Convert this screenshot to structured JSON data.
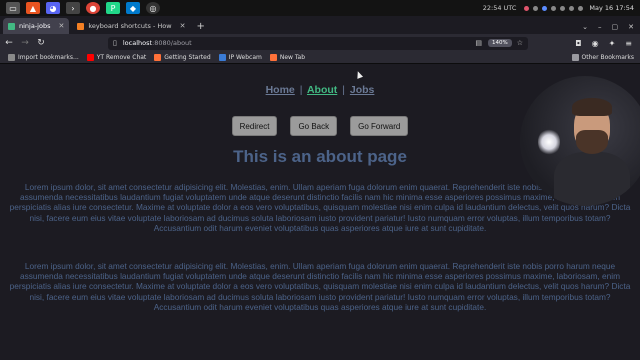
{
  "os": {
    "clock": "22:54 UTC",
    "date_time": "May 16  17:54"
  },
  "tabs": [
    {
      "label": "ninja-jobs",
      "active": true
    },
    {
      "label": "keyboard shortcuts - How",
      "active": false
    }
  ],
  "address": {
    "host": "localhost",
    "path": ":8080/about",
    "zoom": "140%"
  },
  "bookmarks": [
    {
      "label": "Import bookmarks...",
      "color": "#8a8a8a"
    },
    {
      "label": "YT Remove Chat",
      "color": "#ff0000"
    },
    {
      "label": "Getting Started",
      "color": "#ff7139"
    },
    {
      "label": "IP Webcam",
      "color": "#3a7bd5"
    },
    {
      "label": "New Tab",
      "color": "#ff7139"
    }
  ],
  "other_bookmarks": "Other Bookmarks",
  "page": {
    "nav": {
      "home": "Home",
      "about": "About",
      "jobs": "Jobs",
      "pipe": "|"
    },
    "buttons": {
      "redirect": "Redirect",
      "back": "Go Back",
      "forward": "Go Forward"
    },
    "heading": "This is an about page",
    "paragraphs": [
      "Lorem ipsum dolor, sit amet consectetur adipisicing elit. Molestias, enim. Ullam aperiam fuga dolorum enim quaerat. Reprehenderit iste nobis porro harum neque assumenda necessitatibus laudantium fugiat voluptatem unde atque deserunt distinctio facilis nam hic minima esse asperiores possimus maxime, laboriosam, enim perspiciatis alias iure consectetur. Maxime at voluptate dolor a eos vero voluptatibus, quisquam molestiae nisi enim culpa id laudantium delectus, velit quos harum? Dicta nisi, facere eum eius vitae voluptate laboriosam ad ducimus soluta laboriosam iusto provident pariatur! Iusto numquam error voluptas, illum temporibus totam? Accusantium odit harum eveniet voluptatibus quas asperiores atque iure at sunt cupiditate.",
      "Lorem ipsum dolor, sit amet consectetur adipisicing elit. Molestias, enim. Ullam aperiam fuga dolorum enim quaerat. Reprehenderit iste nobis porro harum neque assumenda necessitatibus laudantium fugiat voluptatem unde atque deserunt distinctio facilis nam hic minima esse asperiores possimus maxime, laboriosam, enim perspiciatis alias iure consectetur. Maxime at voluptate dolor a eos vero voluptatibus, quisquam molestiae nisi enim culpa id laudantium delectus, velit quos harum? Dicta nisi, facere eum eius vitae voluptate laboriosam ad ducimus soluta laboriosam iusto provident pariatur! Iusto numquam error voluptas, illum temporibus totam? Accusantium odit harum eveniet voluptatibus quas asperiores atque iure at sunt cupiditate."
    ]
  },
  "colors": {
    "link_active": "#42b983",
    "link": "#6b7a96",
    "text": "#4c6389",
    "page_bg": "#1c1b22"
  }
}
